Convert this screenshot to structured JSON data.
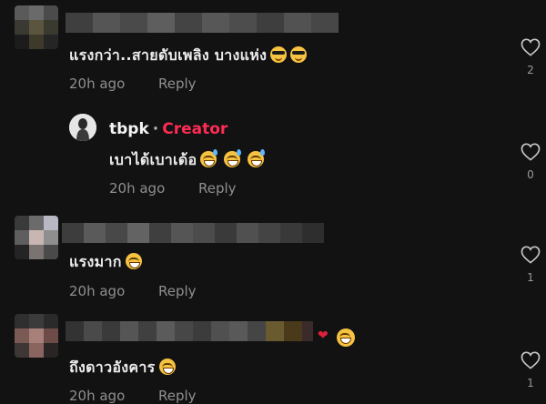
{
  "comments": [
    {
      "text": "แรงกว่า..สายดับเพลิง บางแห่ง",
      "time": "20h ago",
      "reply": "Reply",
      "likes": "2",
      "emojis": [
        "sunglasses-emoji",
        "sunglasses-emoji"
      ]
    },
    {
      "username": "tbpk",
      "separator": "·",
      "badge": "Creator",
      "text": "เบาได้เบาเด้อ",
      "time": "20h ago",
      "reply": "Reply",
      "likes": "0",
      "emojis": [
        "grinning-sweat-emoji",
        "grinning-sweat-emoji",
        "grinning-sweat-emoji"
      ]
    },
    {
      "text": "แรงมาก",
      "time": "20h ago",
      "reply": "Reply",
      "likes": "1",
      "emojis": [
        "tears-of-joy-emoji"
      ]
    },
    {
      "text": "ถึงดาวอังคาร",
      "time": "20h ago",
      "reply": "Reply",
      "likes": "1",
      "emojis": [
        "tears-of-joy-emoji"
      ],
      "name_suffix_emojis": [
        "heart-emoji",
        "tears-of-joy-emoji"
      ]
    }
  ],
  "colors": {
    "background": "#121212",
    "creator_badge": "#fe2c55",
    "meta_text": "#8f8f8f"
  }
}
